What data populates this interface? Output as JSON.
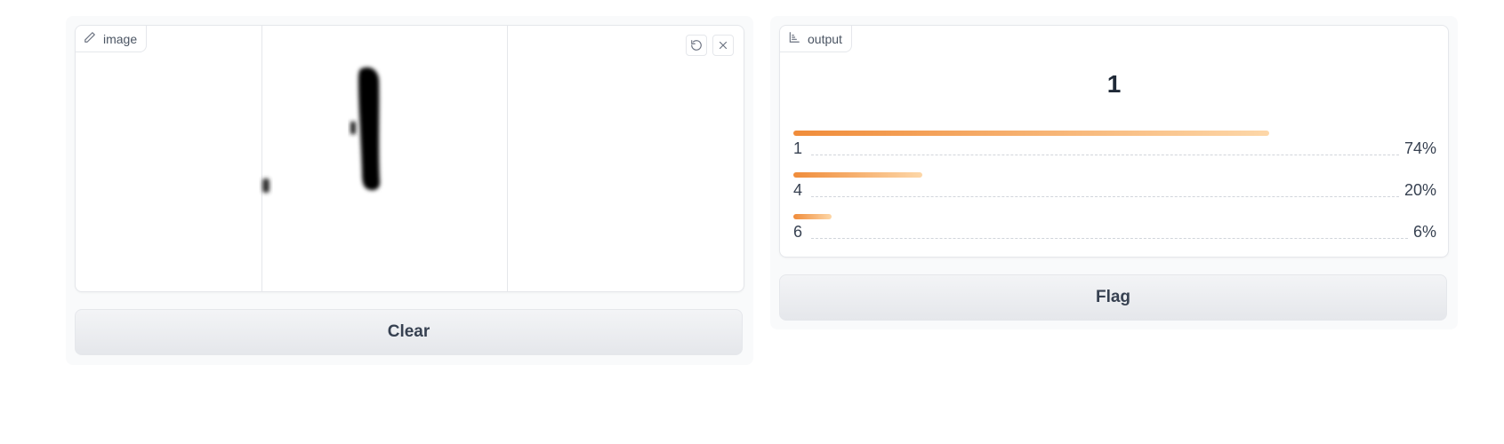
{
  "image_input": {
    "label": "image",
    "icon": "pencil-icon",
    "undo_icon": "undo-icon",
    "close_icon": "close-icon"
  },
  "clear_button": {
    "label": "Clear"
  },
  "output": {
    "label": "output",
    "icon": "bar-chart-icon",
    "predicted": "1",
    "confidences": [
      {
        "label": "1",
        "value": "74%",
        "fraction": 0.74
      },
      {
        "label": "4",
        "value": "20%",
        "fraction": 0.2
      },
      {
        "label": "6",
        "value": "6%",
        "fraction": 0.06
      }
    ]
  },
  "flag_button": {
    "label": "Flag"
  },
  "colors": {
    "bar_start": "#f08c3a",
    "bar_end": "#fdd7a8",
    "panel_bg": "#f9fafb",
    "border": "#e5e7eb"
  }
}
